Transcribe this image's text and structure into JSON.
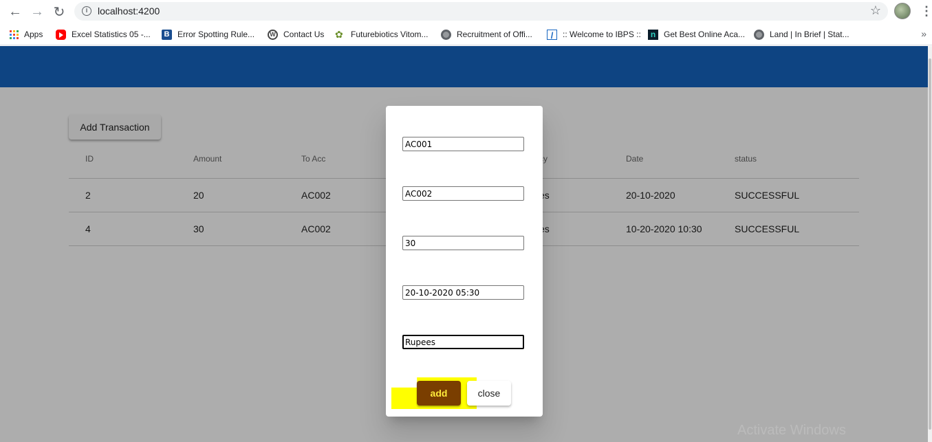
{
  "browser": {
    "url": "localhost:4200",
    "bookmarks": [
      {
        "label": "Apps",
        "icon": "apps-grid-icon"
      },
      {
        "label": "Excel Statistics 05 -...",
        "icon": "youtube-icon"
      },
      {
        "label": "Error Spotting Rule...",
        "icon": "b-logo-icon"
      },
      {
        "label": "Contact Us",
        "icon": "wordpress-icon"
      },
      {
        "label": "Futurebiotics Vitom...",
        "icon": "leaf-icon"
      },
      {
        "label": "Recruitment of Offi...",
        "icon": "globe-icon"
      },
      {
        "label": ":: Welcome to IBPS ::",
        "icon": "ibps-icon"
      },
      {
        "label": "Get Best Online Aca...",
        "icon": "n-logo-icon"
      },
      {
        "label": "Land | In Brief | Stat...",
        "icon": "globe-icon"
      }
    ],
    "more_bookmarks": "»"
  },
  "app": {
    "header_color": "#1565c0",
    "add_transaction_label": "Add Transaction",
    "table": {
      "columns": [
        "ID",
        "Amount",
        "To Acc",
        "",
        "cy",
        "Date",
        "status"
      ],
      "rows": [
        [
          "2",
          "20",
          "AC002",
          "",
          "es",
          "20-10-2020",
          "SUCCESSFUL"
        ],
        [
          "4",
          "30",
          "AC002",
          "",
          "es",
          "10-20-2020 10:30",
          "SUCCESSFUL"
        ]
      ]
    }
  },
  "dialog": {
    "fields": [
      {
        "value": "AC001"
      },
      {
        "value": "AC002"
      },
      {
        "value": "30"
      },
      {
        "value": "20-10-2020 05:30"
      },
      {
        "value": "Rupees"
      }
    ],
    "add_label": "add",
    "close_label": "close",
    "add_button_bg": "#7a3e00",
    "add_button_text": "#ffeb3b",
    "highlight_color": "#ffff00"
  },
  "watermark": "Activate Windows"
}
